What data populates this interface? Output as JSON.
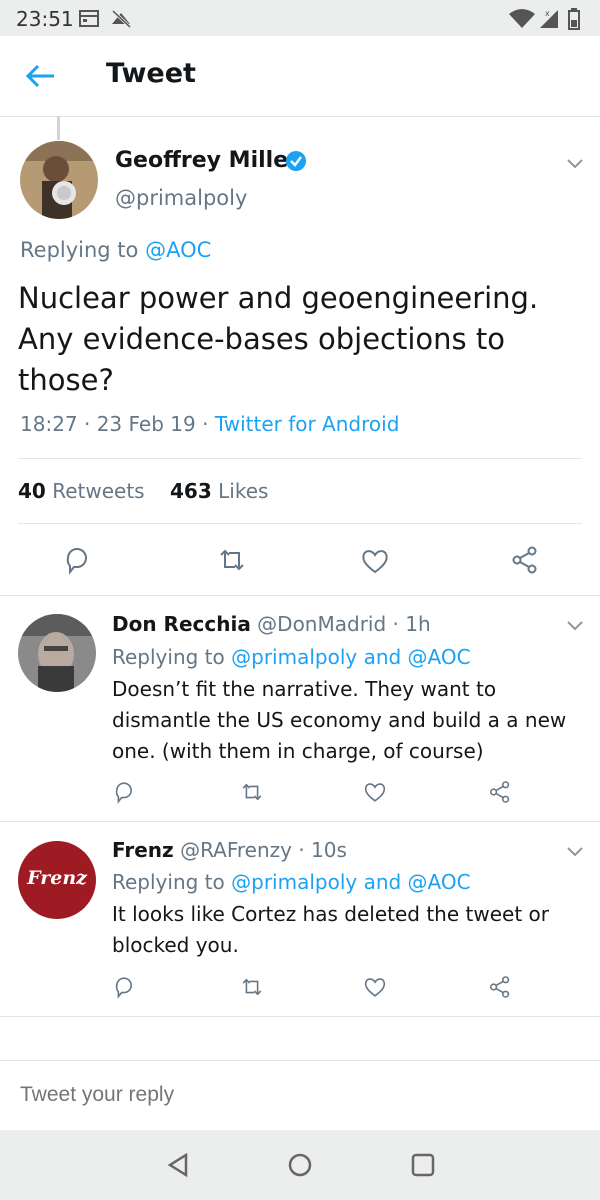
{
  "status_bar": {
    "time": "23:51"
  },
  "header": {
    "title": "Tweet"
  },
  "tweet": {
    "author_name": "Geoffrey Miller",
    "author_handle": "@primalpoly",
    "replying_label": "Replying to ",
    "replying_to": "@AOC",
    "text": "Nuclear power and geoengineering. Any evidence-bases objections to those?",
    "time": "18:27 · 23 Feb 19 · ",
    "source": "Twitter for Android",
    "retweets_count": "40",
    "retweets_label": "Retweets",
    "likes_count": "463",
    "likes_label": "Likes"
  },
  "replies": [
    {
      "name": "Don Recchia",
      "handle": "@DonMadrid",
      "time": " · 1h",
      "replying_label": "Replying to ",
      "replying_to": "@primalpoly and @AOC",
      "text": "Doesn’t fit the narrative.  They want to dismantle the US economy and build a a new one. (with them in charge, of course)"
    },
    {
      "name": "Frenz",
      "handle": "@RAFrenzy",
      "time": " · 10s",
      "avatar_text": "Frenz",
      "replying_label": "Replying to ",
      "replying_to": "@primalpoly and @AOC",
      "text": "It looks like Cortez has deleted the tweet or blocked you."
    }
  ],
  "compose": {
    "placeholder": "Tweet your reply"
  },
  "colors": {
    "accent": "#1da1f2",
    "secondary_text": "#657786",
    "frenz_avatar": "#9e1b23"
  }
}
